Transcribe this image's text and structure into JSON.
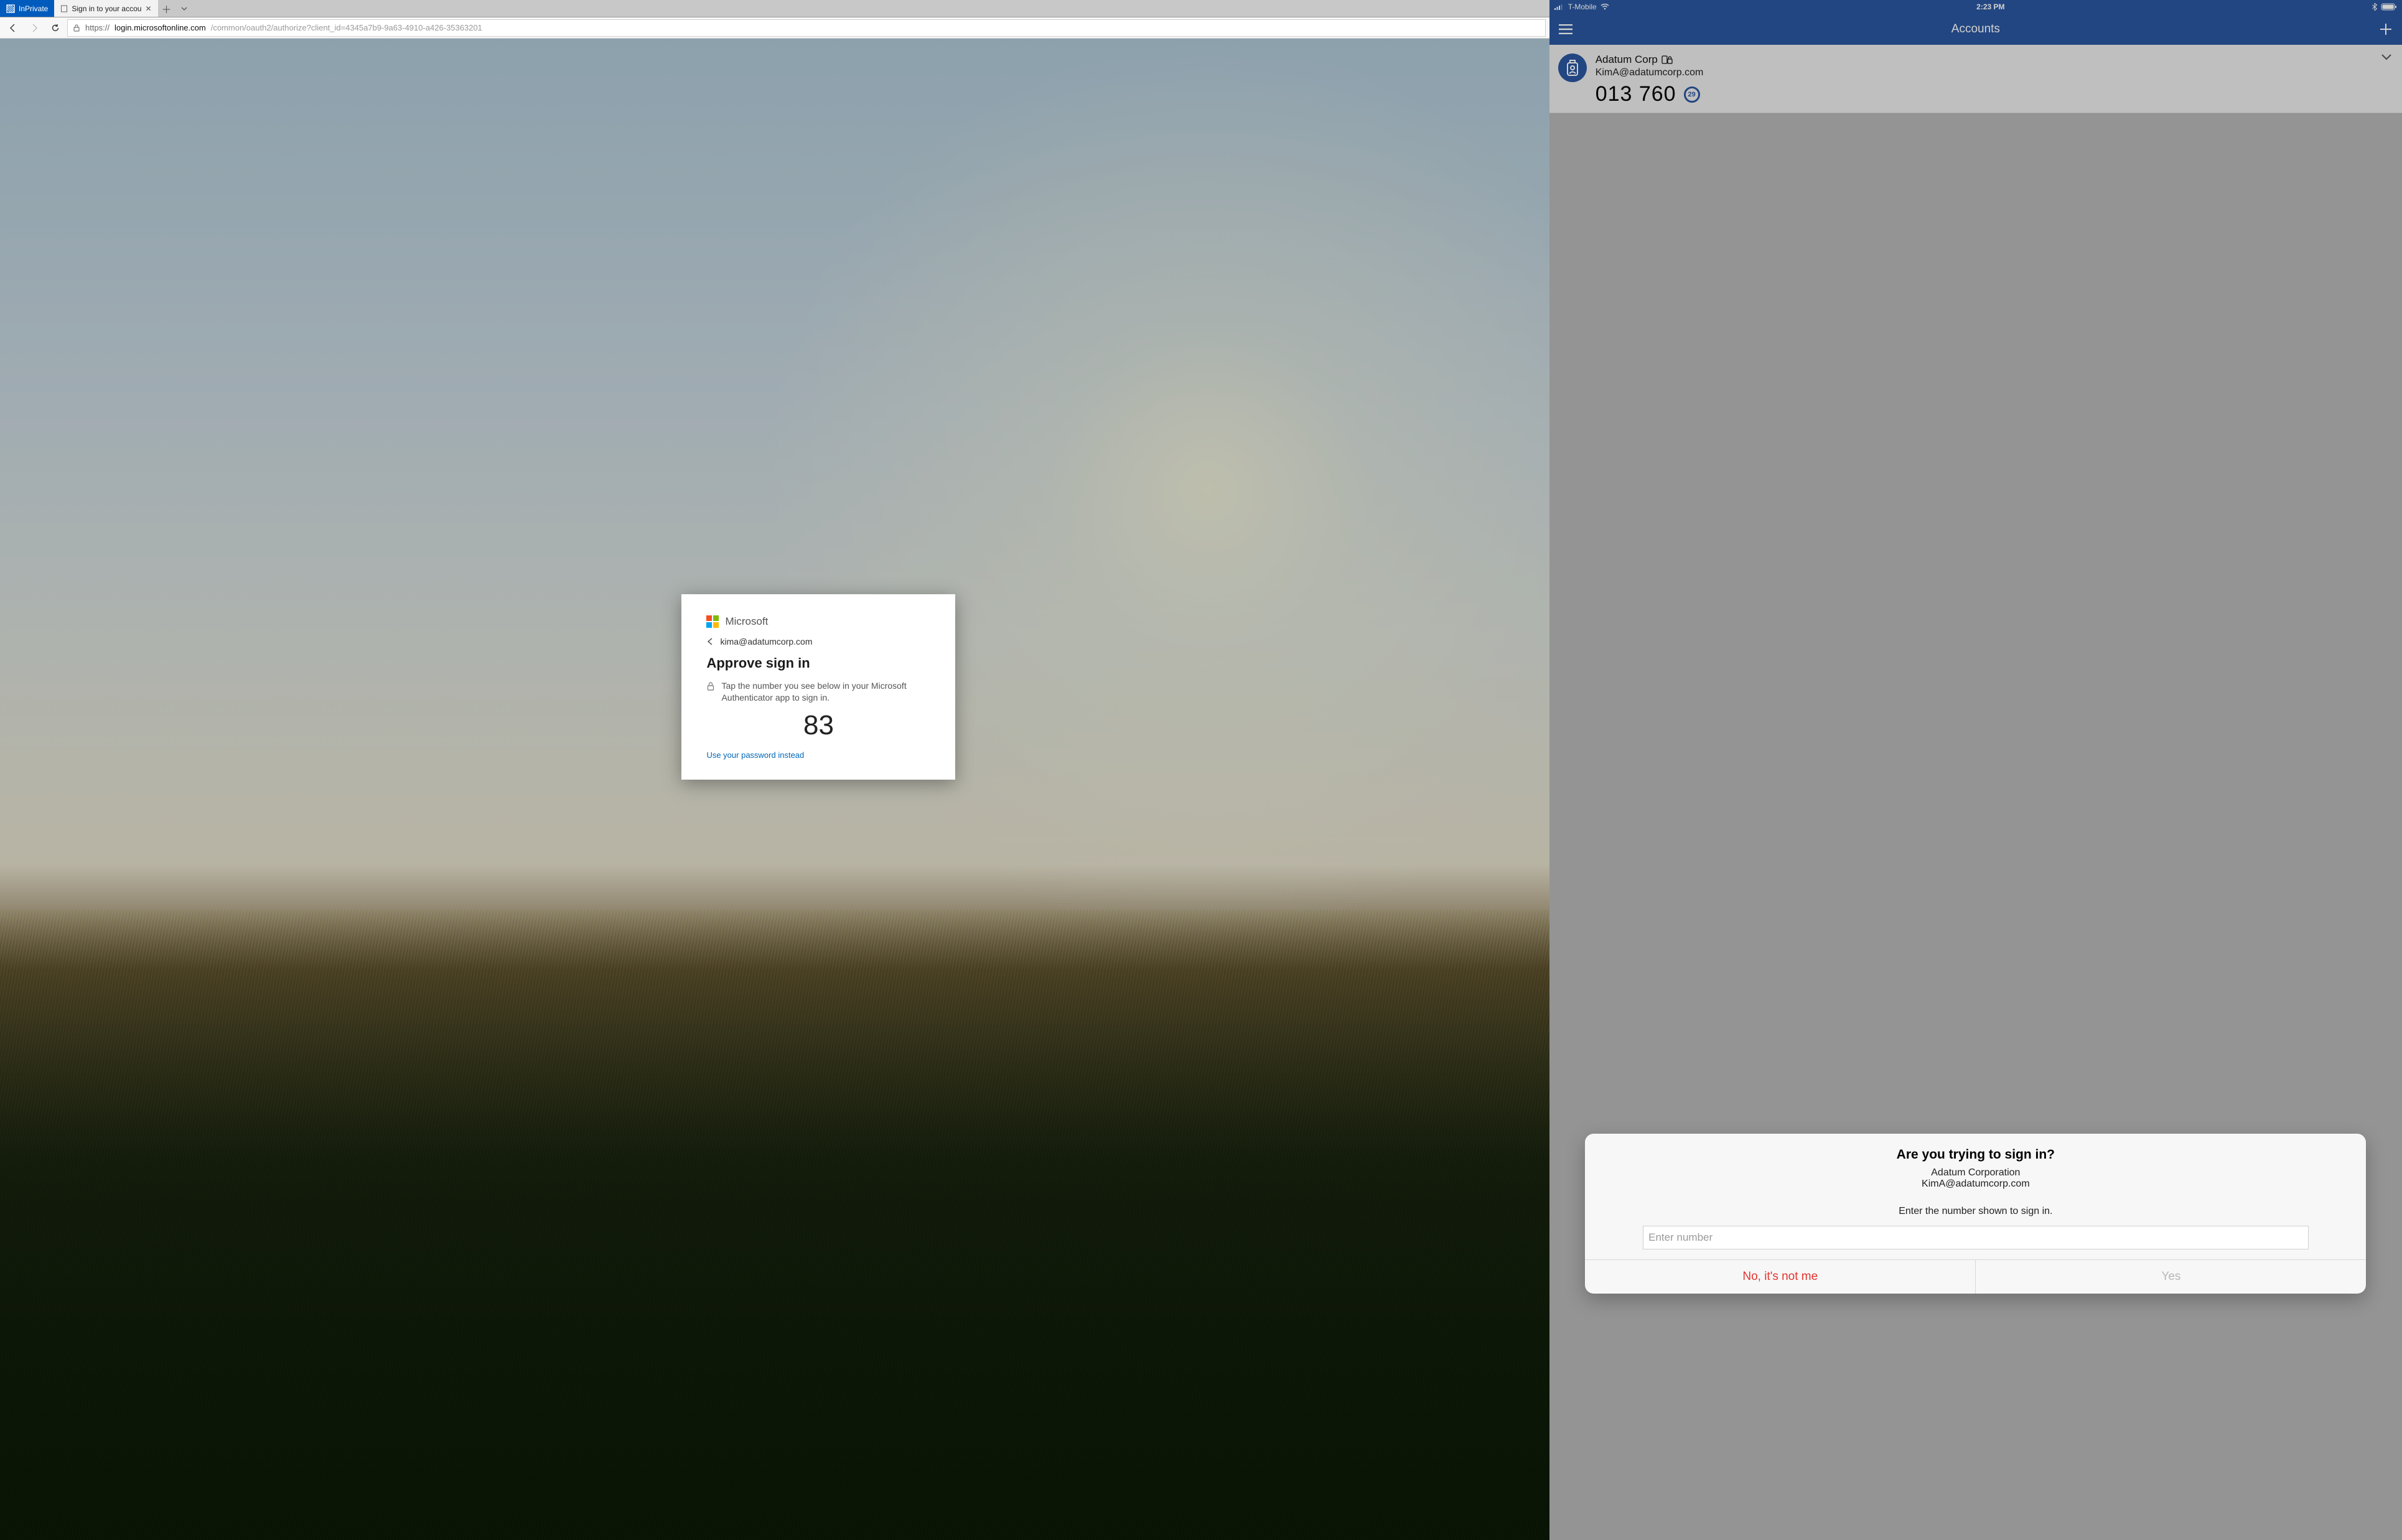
{
  "browser": {
    "inprivate_label": "InPrivate",
    "tab_title": "Sign in to your accou",
    "url": "https://login.microsoftonline.com/common/oauth2/authorize?client_id=4345a7b9-9a63-4910-a426-35363201",
    "url_scheme": "https://",
    "url_host": "login.microsoftonline.com",
    "url_path": "/common/oauth2/authorize?client_id=4345a7b9-9a63-4910-a426-35363201"
  },
  "signin": {
    "brand": "Microsoft",
    "user": "kima@adatumcorp.com",
    "heading": "Approve sign in",
    "tap_text": "Tap the number you see below in your Microsoft Authenticator app to sign in.",
    "number": "83",
    "alt_link": "Use your password instead"
  },
  "phone": {
    "status": {
      "carrier": "T-Mobile",
      "time": "2:23 PM"
    },
    "nav_title": "Accounts",
    "account": {
      "name": "Adatum Corp",
      "email": "KimA@adatumcorp.com",
      "otp": "013 760",
      "timer": "29"
    },
    "alert": {
      "title": "Are you trying to sign in?",
      "org": "Adatum Corporation",
      "account": "KimA@adatumcorp.com",
      "instruction": "Enter the number shown to sign in.",
      "placeholder": "Enter number",
      "no": "No, it's not me",
      "yes": "Yes"
    }
  }
}
